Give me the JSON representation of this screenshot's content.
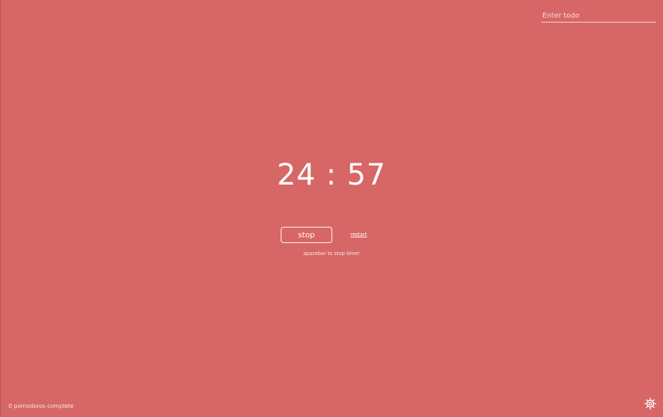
{
  "todo": {
    "placeholder": "Enter todo",
    "value": ""
  },
  "timer": {
    "display": "24 : 57"
  },
  "controls": {
    "stop_label": "stop",
    "restart_label": "restart"
  },
  "hint": "spacebar to stop timer",
  "footer": {
    "pomodoros_status": "0 pomodoros complete",
    "settings_icon": "gear-icon"
  },
  "colors": {
    "background": "#d76766",
    "foreground": "#ffffff"
  }
}
